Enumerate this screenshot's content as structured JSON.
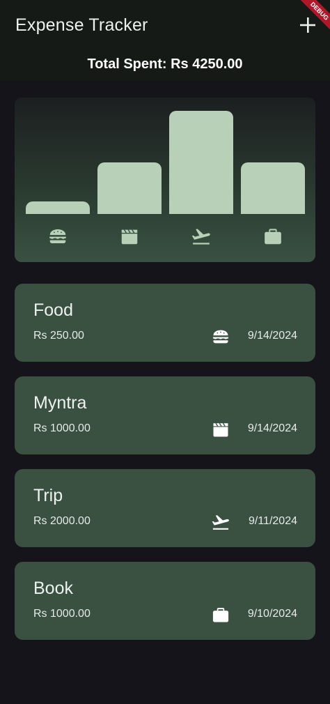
{
  "app_bar": {
    "title": "Expense Tracker",
    "add_icon": "plus-icon",
    "debug_banner": "DEBUG",
    "total_spent": "Total Spent: Rs 4250.00"
  },
  "colors": {
    "background": "#15141a",
    "app_bar": "#151a16",
    "card": "#3a5142",
    "bar": "#b8cfb8",
    "chart_icon": "#b8cfb8",
    "debug_ribbon": "#b0182a"
  },
  "chart": {
    "categories": [
      {
        "id": "food",
        "icon": "burger-icon",
        "level": 0.12
      },
      {
        "id": "leisure",
        "icon": "clapperboard-icon",
        "level": 0.5
      },
      {
        "id": "travel",
        "icon": "flight-takeoff-icon",
        "level": 1.0
      },
      {
        "id": "work",
        "icon": "briefcase-icon",
        "level": 0.5
      }
    ]
  },
  "expenses": [
    {
      "title": "Food",
      "amount": "Rs 250.00",
      "icon": "burger-icon",
      "date": "9/14/2024"
    },
    {
      "title": "Myntra",
      "amount": "Rs 1000.00",
      "icon": "clapperboard-icon",
      "date": "9/14/2024"
    },
    {
      "title": "Trip",
      "amount": "Rs 2000.00",
      "icon": "flight-takeoff-icon",
      "date": "9/11/2024"
    },
    {
      "title": "Book",
      "amount": "Rs 1000.00",
      "icon": "briefcase-icon",
      "date": "9/10/2024"
    }
  ]
}
